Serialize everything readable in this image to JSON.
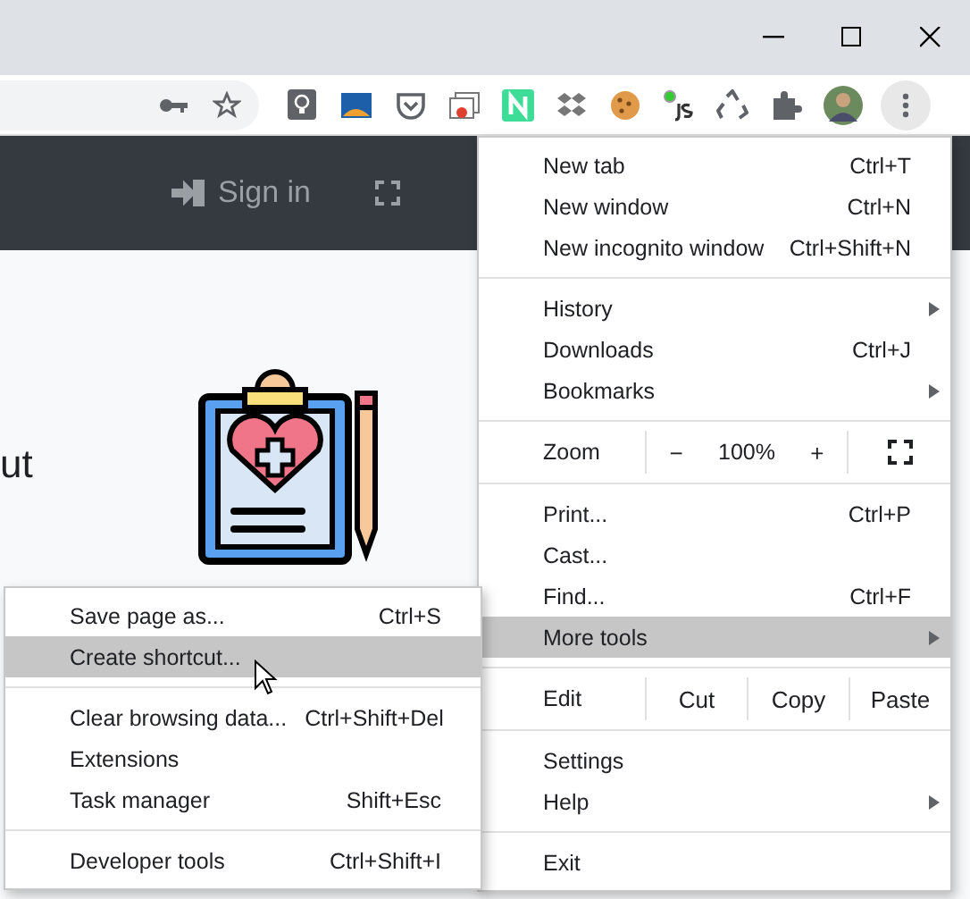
{
  "page": {
    "header": {
      "sign_in": "Sign in"
    },
    "heading": "ut"
  },
  "menu": {
    "items": [
      {
        "kind": "item",
        "label": "New tab",
        "shortcut": "Ctrl+T",
        "submenu": false,
        "selected": false
      },
      {
        "kind": "item",
        "label": "New window",
        "shortcut": "Ctrl+N",
        "submenu": false,
        "selected": false
      },
      {
        "kind": "item",
        "label": "New incognito window",
        "shortcut": "Ctrl+Shift+N",
        "submenu": false,
        "selected": false
      },
      {
        "kind": "separator"
      },
      {
        "kind": "item",
        "label": "History",
        "submenu": true,
        "selected": false
      },
      {
        "kind": "item",
        "label": "Downloads",
        "shortcut": "Ctrl+J",
        "submenu": false,
        "selected": false
      },
      {
        "kind": "item",
        "label": "Bookmarks",
        "submenu": true,
        "selected": false
      },
      {
        "kind": "separator"
      },
      {
        "kind": "zoom",
        "label": "Zoom",
        "minus": "−",
        "value": "100%",
        "plus": "+"
      },
      {
        "kind": "separator"
      },
      {
        "kind": "item",
        "label": "Print...",
        "shortcut": "Ctrl+P",
        "submenu": false,
        "selected": false
      },
      {
        "kind": "item",
        "label": "Cast...",
        "submenu": false,
        "selected": false
      },
      {
        "kind": "item",
        "label": "Find...",
        "shortcut": "Ctrl+F",
        "submenu": false,
        "selected": false
      },
      {
        "kind": "item",
        "label": "More tools",
        "submenu": true,
        "selected": true
      },
      {
        "kind": "separator"
      },
      {
        "kind": "edit",
        "label": "Edit",
        "buttons": [
          "Cut",
          "Copy",
          "Paste"
        ]
      },
      {
        "kind": "separator"
      },
      {
        "kind": "item",
        "label": "Settings",
        "submenu": false,
        "selected": false
      },
      {
        "kind": "item",
        "label": "Help",
        "submenu": true,
        "selected": false
      },
      {
        "kind": "separator"
      },
      {
        "kind": "item",
        "label": "Exit",
        "submenu": false,
        "selected": false
      }
    ]
  },
  "submenu": {
    "items": [
      {
        "kind": "item",
        "label": "Save page as...",
        "shortcut": "Ctrl+S",
        "selected": false
      },
      {
        "kind": "item",
        "label": "Create shortcut...",
        "selected": true
      },
      {
        "kind": "separator"
      },
      {
        "kind": "item",
        "label": "Clear browsing data...",
        "shortcut": "Ctrl+Shift+Del",
        "selected": false
      },
      {
        "kind": "item",
        "label": "Extensions",
        "selected": false
      },
      {
        "kind": "item",
        "label": "Task manager",
        "shortcut": "Shift+Esc",
        "selected": false
      },
      {
        "kind": "separator"
      },
      {
        "kind": "item",
        "label": "Developer tools",
        "shortcut": "Ctrl+Shift+I",
        "selected": false
      }
    ]
  }
}
